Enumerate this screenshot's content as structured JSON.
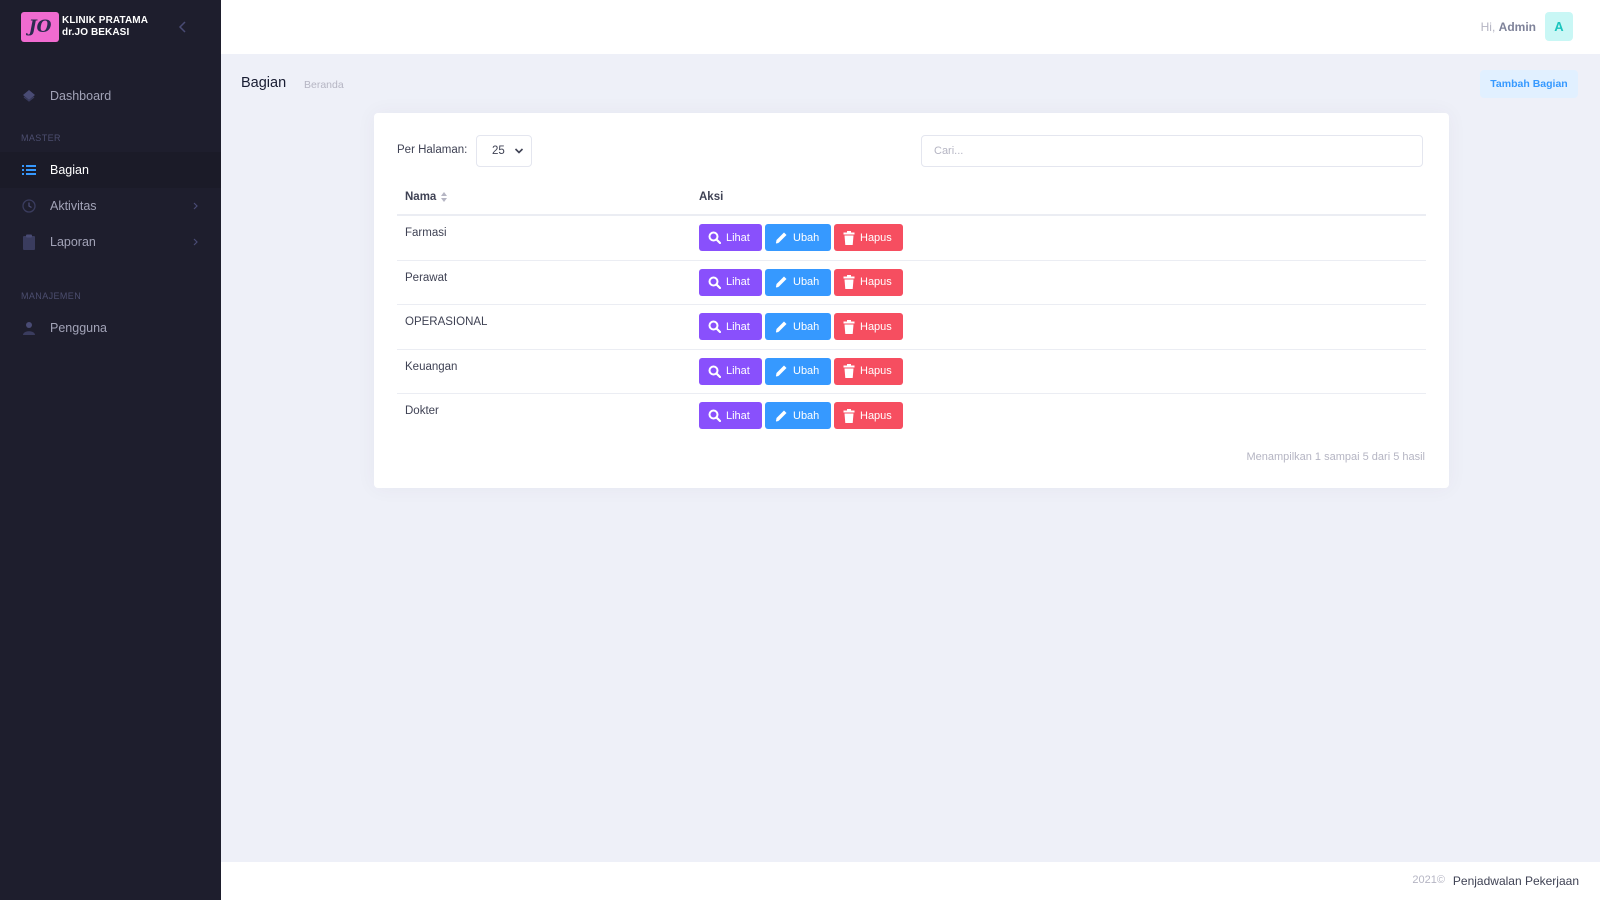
{
  "brand": {
    "logo_text": "JO",
    "line1": "KLINIK PRATAMA",
    "line2": "dr.JO BEKASI"
  },
  "sidebar": {
    "dashboard": "Dashboard",
    "section_master": "MASTER",
    "items": [
      {
        "label": "Bagian",
        "icon": "list-icon",
        "active": true
      },
      {
        "label": "Aktivitas",
        "icon": "clock-icon",
        "has_submenu": true
      },
      {
        "label": "Laporan",
        "icon": "clipboard-icon",
        "has_submenu": true
      }
    ],
    "section_manajemen": "MANAJEMEN",
    "pengguna": "Pengguna"
  },
  "header": {
    "greeting": "Hi,",
    "username": "Admin",
    "avatar_letter": "A"
  },
  "subheader": {
    "title": "Bagian",
    "breadcrumb": "Beranda",
    "add_button": "Tambah Bagian"
  },
  "table_controls": {
    "per_page_label": "Per Halaman:",
    "per_page_value": "25",
    "search_placeholder": "Cari..."
  },
  "table": {
    "columns": [
      "Nama",
      "Aksi"
    ],
    "rows": [
      "Farmasi",
      "Perawat",
      "OPERASIONAL",
      "Keuangan",
      "Dokter"
    ],
    "actions": {
      "view": "Lihat",
      "edit": "Ubah",
      "delete": "Hapus"
    },
    "info": "Menampilkan 1 sampai 5 dari 5 hasil"
  },
  "footer": {
    "year": "2021©",
    "app_name": "Penjadwalan Pekerjaan"
  },
  "colors": {
    "view": "#8950fc",
    "edit": "#3699ff",
    "delete": "#f64e60",
    "sidebar": "#1e1e2d",
    "primary": "#3699ff"
  }
}
